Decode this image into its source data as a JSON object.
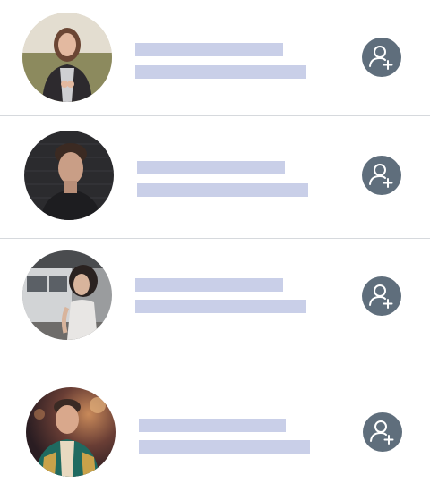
{
  "contacts": [
    {
      "avatar_icon": "avatar-photo-woman-outdoor",
      "add_icon": "add-user-icon"
    },
    {
      "avatar_icon": "avatar-photo-man-dark-wall",
      "add_icon": "add-user-icon"
    },
    {
      "avatar_icon": "avatar-photo-woman-train",
      "add_icon": "add-user-icon"
    },
    {
      "avatar_icon": "avatar-photo-man-jacket",
      "add_icon": "add-user-icon"
    }
  ],
  "colors": {
    "placeholder": "#c9cfe8",
    "add_button": "#5f6e7c",
    "divider": "#d6d9dd",
    "background": "#ffffff"
  }
}
